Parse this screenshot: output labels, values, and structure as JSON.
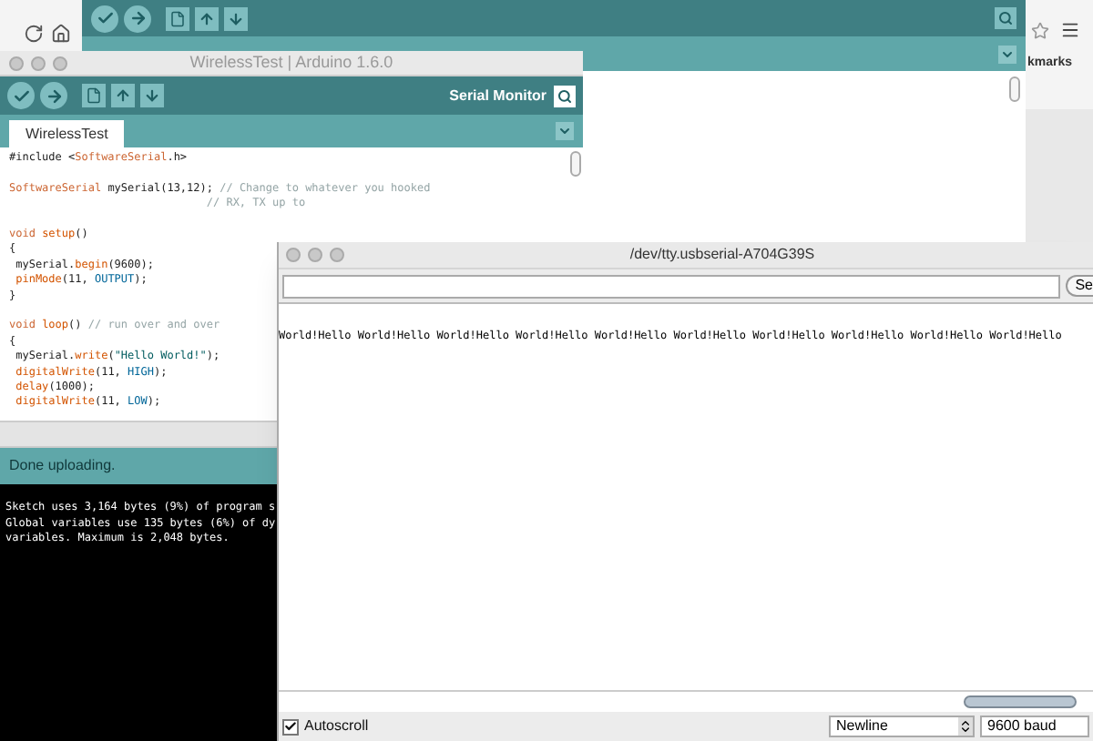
{
  "browser": {
    "bookmarks_label": "kmarks"
  },
  "arduino_window": {
    "title": "WirelessTest | Arduino 1.6.0",
    "serial_monitor_label": "Serial Monitor",
    "tabs": [
      {
        "label": "WirelessTest",
        "selected": true
      }
    ],
    "code_blocks": [
      {
        "lines": [
          {
            "segments": [
              {
                "kind": "plain",
                "text": "#include <"
              },
              {
                "kind": "keyword",
                "text": "SoftwareSerial"
              },
              {
                "kind": "plain",
                "text": ".h>"
              }
            ]
          }
        ]
      },
      {
        "lines": [
          {
            "segments": [
              {
                "kind": "keyword",
                "text": "SoftwareSerial"
              },
              {
                "kind": "plain",
                "text": " mySerial(13,12); "
              },
              {
                "kind": "comment",
                "text": "// Change to whatever you hooked"
              }
            ]
          },
          {
            "segments": [
              {
                "kind": "comment",
                "text": "                              // RX, TX up to"
              }
            ]
          }
        ]
      },
      {
        "lines": [
          {
            "segments": [
              {
                "kind": "keyword",
                "text": "void"
              },
              {
                "kind": "function",
                "text": " setup"
              },
              {
                "kind": "plain",
                "text": "()"
              }
            ]
          },
          {
            "segments": [
              {
                "kind": "plain",
                "text": "{"
              }
            ]
          },
          {
            "segments": [
              {
                "kind": "plain",
                "text": " mySerial."
              },
              {
                "kind": "function",
                "text": "begin"
              },
              {
                "kind": "plain",
                "text": "(9600);"
              }
            ]
          },
          {
            "segments": [
              {
                "kind": "function",
                "text": " pinMode"
              },
              {
                "kind": "plain",
                "text": "(11, "
              },
              {
                "kind": "constant",
                "text": "OUTPUT"
              },
              {
                "kind": "plain",
                "text": ");"
              }
            ]
          },
          {
            "segments": [
              {
                "kind": "plain",
                "text": "}"
              }
            ]
          }
        ]
      },
      {
        "lines": [
          {
            "segments": [
              {
                "kind": "keyword",
                "text": "void"
              },
              {
                "kind": "function",
                "text": " loop"
              },
              {
                "kind": "plain",
                "text": "() "
              },
              {
                "kind": "comment",
                "text": "// run over and over"
              }
            ]
          },
          {
            "segments": [
              {
                "kind": "plain",
                "text": "{"
              }
            ]
          },
          {
            "segments": [
              {
                "kind": "plain",
                "text": " mySerial."
              },
              {
                "kind": "function",
                "text": "write"
              },
              {
                "kind": "plain",
                "text": "("
              },
              {
                "kind": "string",
                "text": "\"Hello World!\""
              },
              {
                "kind": "plain",
                "text": ");"
              }
            ]
          },
          {
            "segments": [
              {
                "kind": "function",
                "text": " digitalWrite"
              },
              {
                "kind": "plain",
                "text": "(11, "
              },
              {
                "kind": "constant",
                "text": "HIGH"
              },
              {
                "kind": "plain",
                "text": ");"
              }
            ]
          },
          {
            "segments": [
              {
                "kind": "function",
                "text": " delay"
              },
              {
                "kind": "plain",
                "text": "(1000);"
              }
            ]
          },
          {
            "segments": [
              {
                "kind": "function",
                "text": " digitalWrite"
              },
              {
                "kind": "plain",
                "text": "(11, "
              },
              {
                "kind": "constant",
                "text": "LOW"
              },
              {
                "kind": "plain",
                "text": ");"
              }
            ]
          }
        ]
      }
    ],
    "status": "Done uploading.",
    "console_lines": [
      "Sketch uses 3,164 bytes (9%) of program s",
      "Global variables use 135 bytes (6%) of dy",
      "variables. Maximum is 2,048 bytes."
    ]
  },
  "serial_monitor": {
    "title": "/dev/tty.usbserial-A704G39S",
    "send_button": "Se",
    "output": "World!Hello World!Hello World!Hello World!Hello World!Hello World!Hello World!Hello World!Hello World!Hello World!Hello",
    "autoscroll": {
      "label": "Autoscroll",
      "checked": true
    },
    "line_ending": "Newline",
    "baud": "9600 baud"
  }
}
